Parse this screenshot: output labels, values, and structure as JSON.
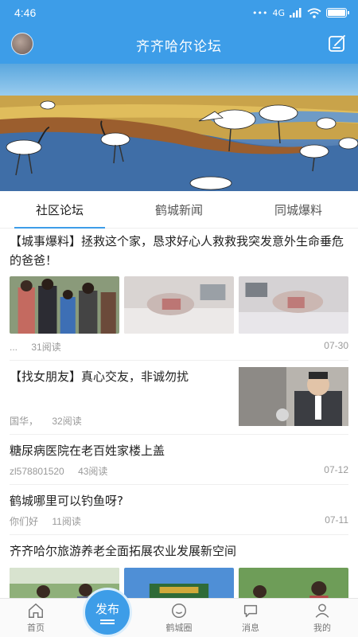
{
  "status_bar": {
    "time": "4:46",
    "network": "4G",
    "battery_level": 0.9
  },
  "navbar": {
    "title": "齐齐哈尔论坛"
  },
  "tabs": [
    {
      "label": "社区论坛",
      "active": true
    },
    {
      "label": "鹤城新闻",
      "active": false
    },
    {
      "label": "同城爆料",
      "active": false
    }
  ],
  "posts": [
    {
      "title": "【城事爆料】拯救这个家，恳求好心人救救我突发意外生命垂危的爸爸！",
      "author": "...",
      "reads": "31阅读",
      "date": "07-30"
    },
    {
      "title": "【找女朋友】真心交友，非诚勿扰",
      "author": "国华，",
      "reads": "32阅读",
      "date": ""
    },
    {
      "title": "糖尿病医院在老百姓家楼上盖",
      "author": "zl578801520",
      "reads": "43阅读",
      "date": "07-12"
    },
    {
      "title": "鹤城哪里可以钓鱼呀?",
      "author": "你们好",
      "reads": "11阅读",
      "date": "07-11"
    },
    {
      "title": "齐齐哈尔旅游养老全面拓展农业发展新空间",
      "author": "",
      "reads": "",
      "date": ""
    }
  ],
  "bottom_nav": [
    {
      "label": "首页",
      "icon": "home-icon"
    },
    {
      "label": "鹤城圈",
      "icon": "circle-chat-icon"
    },
    {
      "label": "消息",
      "icon": "message-icon"
    },
    {
      "label": "我的",
      "icon": "user-icon"
    }
  ],
  "publish_label": "发布",
  "colors": {
    "primary": "#3d9de8"
  }
}
